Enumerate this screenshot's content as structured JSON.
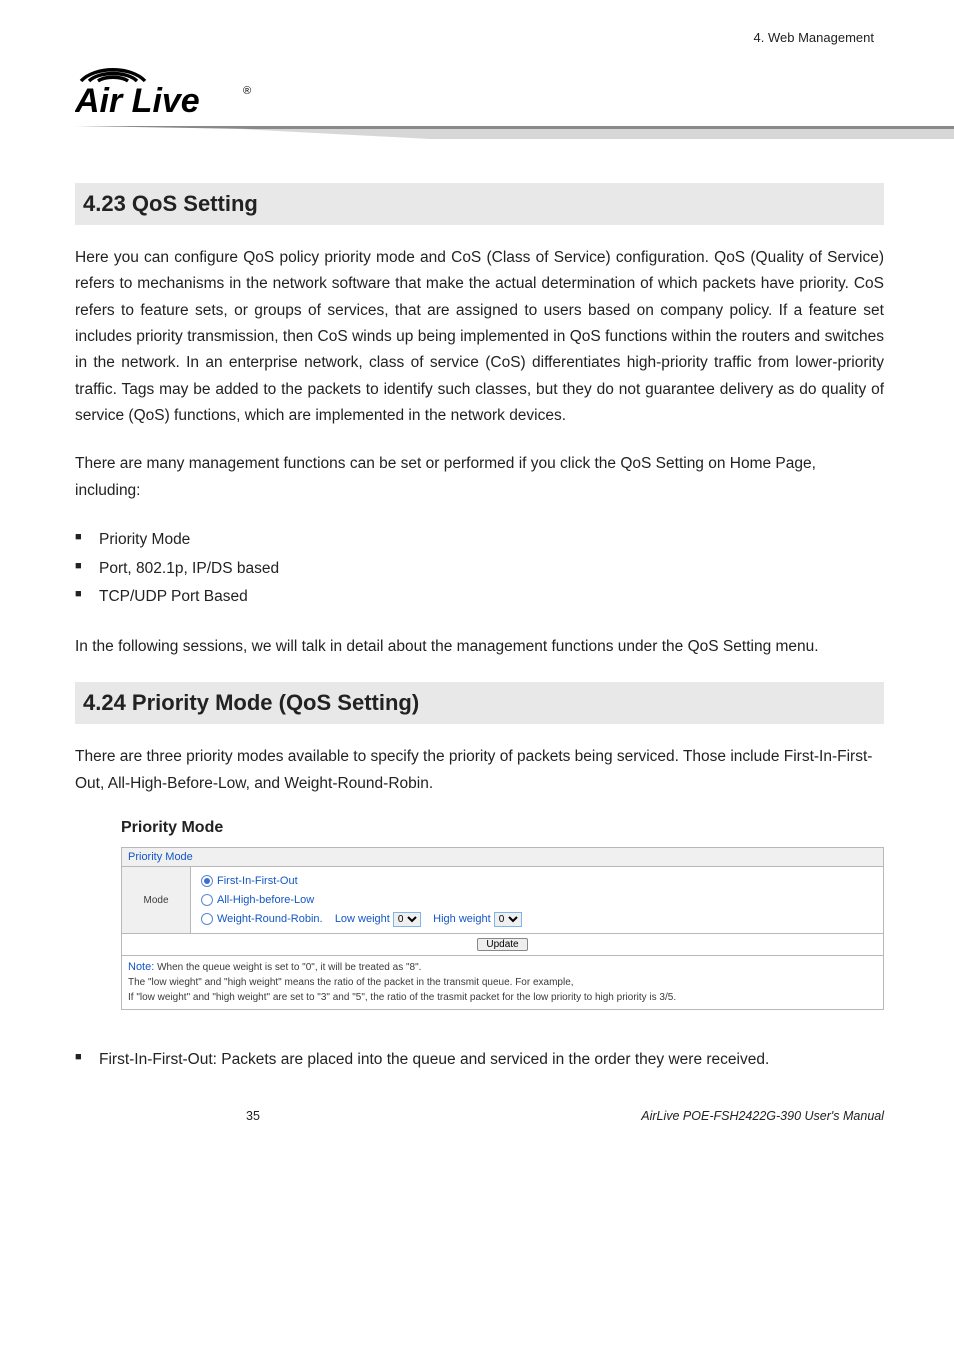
{
  "header": {
    "chapter": "4. Web Management"
  },
  "logo": {
    "name": "Air Live",
    "reg": "®"
  },
  "section_4_23": {
    "title": "4.23 QoS Setting",
    "para1": "Here you can configure QoS policy priority mode and CoS (Class of Service) configuration. QoS (Quality of Service) refers to mechanisms in the network software that make the actual determination of which packets have priority. CoS refers to feature sets, or groups of services, that are assigned to users based on company policy. If a feature set includes priority transmission, then CoS winds up being implemented in QoS functions within the routers and switches in the network. In an enterprise network, class of service (CoS) differentiates high-priority traffic from lower-priority traffic. Tags may be added to the packets to identify such classes, but they do not guarantee delivery as do quality of service (QoS) functions, which are implemented in the network devices.",
    "para2": "There are many management functions can be set or performed if you click the QoS Setting on Home Page, including:",
    "items": [
      "Priority Mode",
      "Port, 802.1p, IP/DS based",
      "TCP/UDP Port Based"
    ],
    "para3": "In the following sessions, we will talk in detail about the management functions under the QoS Setting menu."
  },
  "section_4_24": {
    "title": "4.24 Priority Mode (QoS Setting)",
    "para1": "There are three priority modes available to specify the priority of packets being serviced. Those include First-In-First-Out, All-High-Before-Low, and Weight-Round-Robin.",
    "subhead": "Priority Mode",
    "box": {
      "header": "Priority Mode",
      "mode_label": "Mode",
      "opt1": "First-In-First-Out",
      "opt2": "All-High-before-Low",
      "opt3a": "Weight-Round-Robin.",
      "opt3b": "Low weight",
      "opt3c": "High weight",
      "sel_val": "0",
      "update": "Update",
      "note_k": "Note:",
      "note_l1": " When the queue weight is set to \"0\", it will be treated as \"8\".",
      "note_l2": "The \"low wieght\" and \"high weight\" means the ratio of the packet in the transmit queue. For example,",
      "note_l3": "If \"low weight\" and \"high weight\" are set to \"3\" and \"5\", the ratio of the trasmit packet for the low priority to high priority is 3/5."
    },
    "items": [
      "First-In-First-Out: Packets are placed into the queue and serviced in the order they were received."
    ]
  },
  "footer": {
    "page": "35",
    "manual": "AirLive POE-FSH2422G-390 User's Manual"
  },
  "chart_data": null
}
